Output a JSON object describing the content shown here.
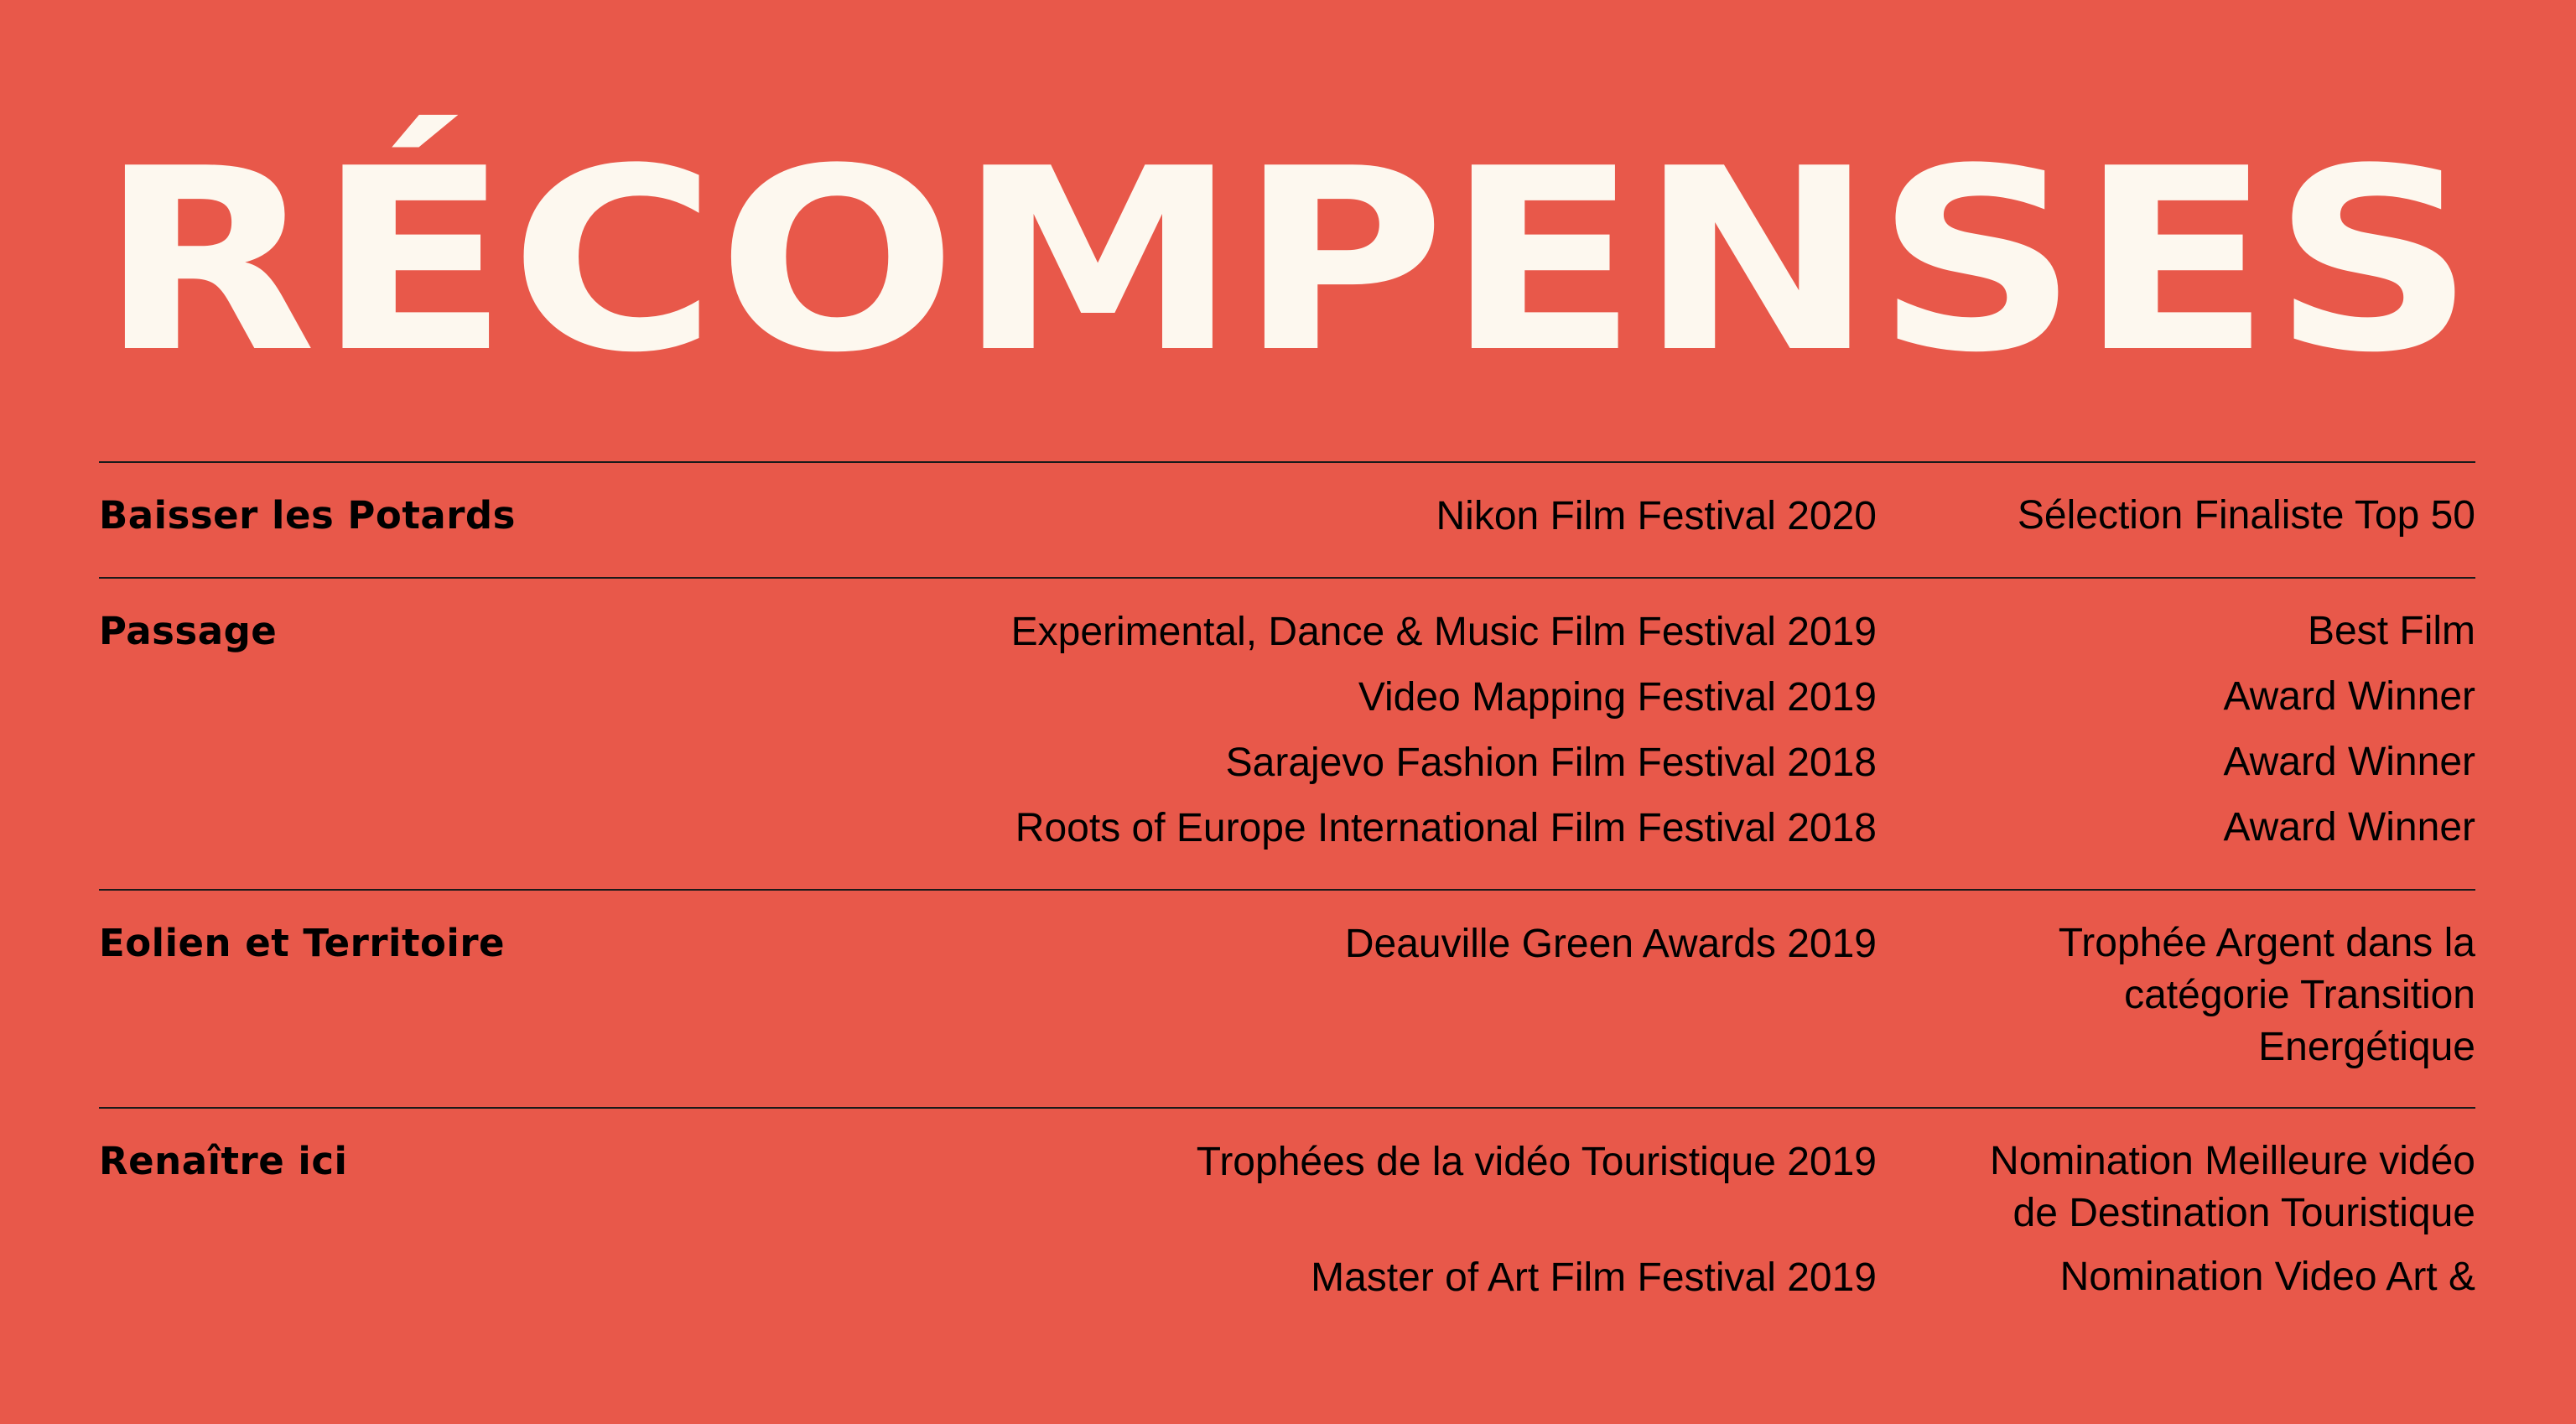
{
  "page": {
    "title": "RÉCOMPENSES"
  },
  "awards": [
    {
      "project": "Baisser les Potards",
      "entries": [
        {
          "festival": "Nikon Film Festival 2020",
          "result": "Sélection Finaliste Top 50"
        }
      ]
    },
    {
      "project": "Passage",
      "entries": [
        {
          "festival": "Experimental, Dance & Music Film Festival 2019",
          "result": "Best Film"
        },
        {
          "festival": "Video Mapping Festival 2019",
          "result": "Award Winner"
        },
        {
          "festival": "Sarajevo Fashion Film Festival 2018",
          "result": "Award Winner"
        },
        {
          "festival": "Roots of Europe International Film Festival 2018",
          "result": "Award Winner"
        }
      ]
    },
    {
      "project": "Eolien et Territoire",
      "entries": [
        {
          "festival": "Deauville Green Awards 2019",
          "result": "Trophée Argent dans la catégorie Transition Energétique"
        }
      ]
    },
    {
      "project": "Renaître ici",
      "entries": [
        {
          "festival": "Trophées de la vidéo Touristique 2019",
          "result": "Nomination Meilleure vidéo de Destination Touristique"
        },
        {
          "festival": "Master of Art Film Festival 2019",
          "result": "Nomination Video Art &"
        }
      ]
    }
  ]
}
